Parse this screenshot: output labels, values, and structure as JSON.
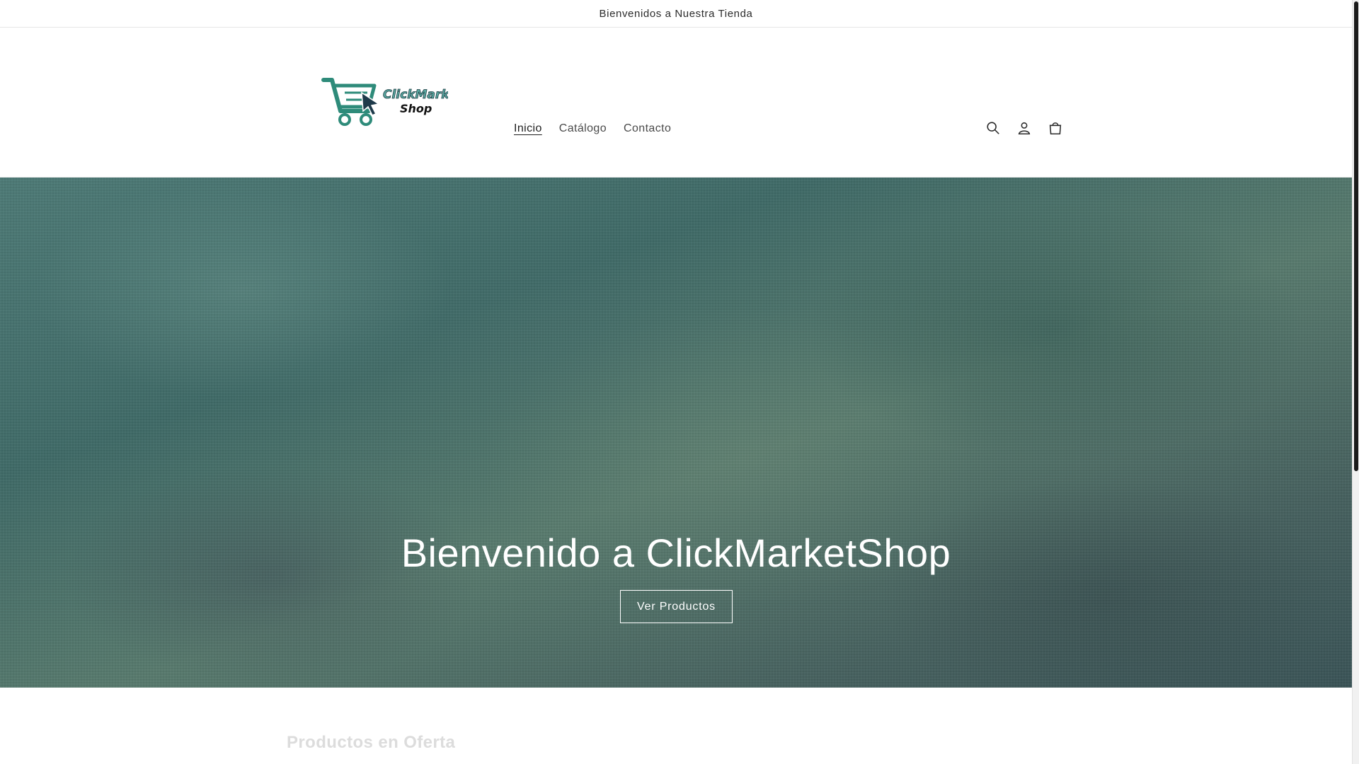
{
  "announcement": {
    "text": "Bienvenidos a Nuestra Tienda"
  },
  "header": {
    "logo": {
      "line1": "ClickMarket",
      "line2": "Shop"
    },
    "nav": [
      {
        "label": "Inicio",
        "active": true
      },
      {
        "label": "Catálogo",
        "active": false
      },
      {
        "label": "Contacto",
        "active": false
      }
    ],
    "icons": [
      "search-icon",
      "account-icon",
      "cart-icon"
    ]
  },
  "hero": {
    "title": "Bienvenido a ClickMarketShop",
    "button_label": "Ver Productos"
  },
  "section": {
    "title": "Productos en Oferta"
  },
  "colors": {
    "brand_teal": "#2e8b7a",
    "hero_base": "#4d7a76",
    "text_dark": "#121212"
  }
}
